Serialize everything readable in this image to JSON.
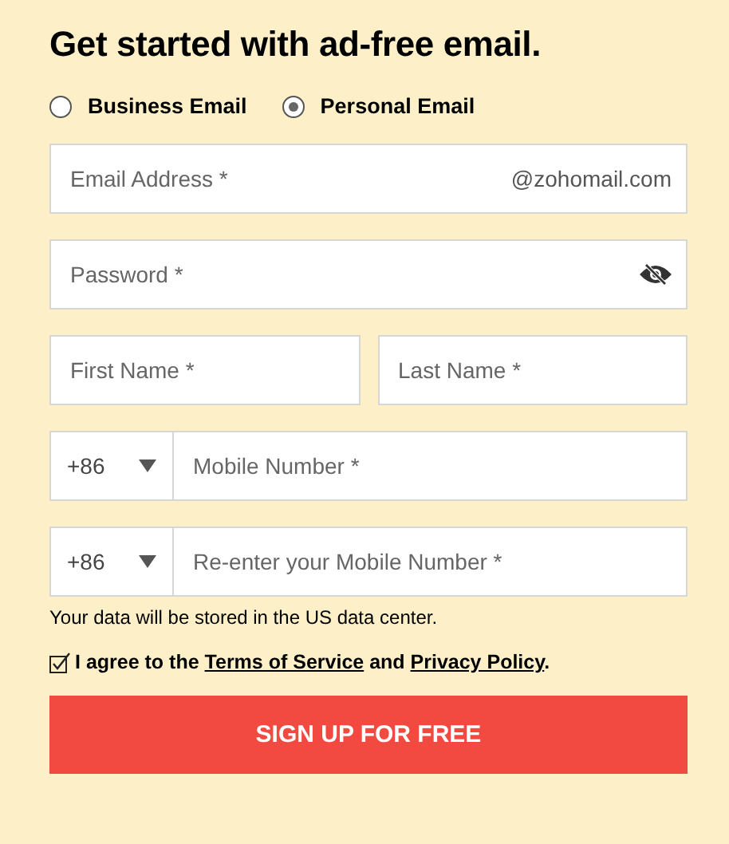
{
  "title": "Get started with ad-free email.",
  "account_types": [
    {
      "label": "Business Email",
      "selected": false
    },
    {
      "label": "Personal Email",
      "selected": true
    }
  ],
  "fields": [
    {
      "kind": "email",
      "placeholder": "Email Address *",
      "suffix": "@zohomail.com"
    },
    {
      "kind": "password",
      "placeholder": "Password *"
    },
    {
      "kind": "pair",
      "items": [
        {
          "placeholder": "First Name *"
        },
        {
          "placeholder": "Last Name *"
        }
      ]
    },
    {
      "kind": "phone",
      "country_code": "+86",
      "placeholder": "Mobile Number *"
    },
    {
      "kind": "phone",
      "country_code": "+86",
      "placeholder": "Re-enter your Mobile Number *"
    }
  ],
  "data_note": "Your data will be stored in the US data center.",
  "agreement": {
    "checked": true,
    "parts": [
      {
        "kind": "text",
        "text": "I agree to the "
      },
      {
        "kind": "link",
        "text": "Terms of Service"
      },
      {
        "kind": "text",
        "text": " and "
      },
      {
        "kind": "link",
        "text": "Privacy Policy"
      },
      {
        "kind": "text",
        "text": "."
      }
    ]
  },
  "submit_button": "SIGN UP FOR FREE"
}
